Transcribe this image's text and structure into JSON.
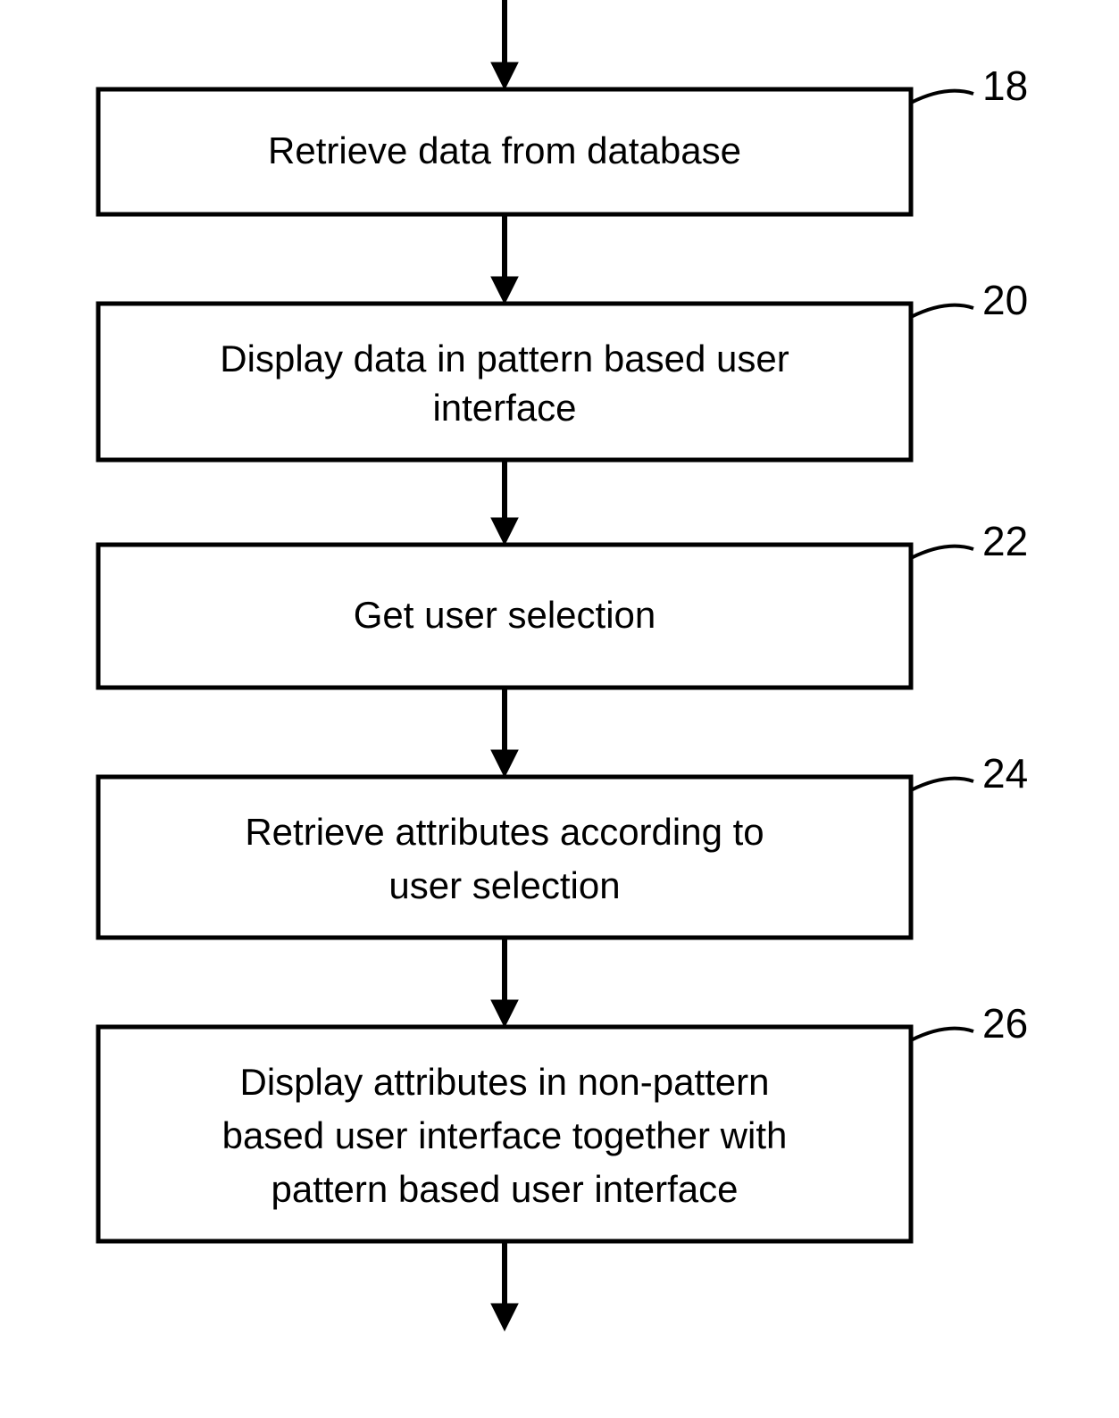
{
  "diagram": {
    "type": "flowchart",
    "orientation": "vertical",
    "steps": [
      {
        "id": "18",
        "label": "18",
        "lines": [
          "Retrieve data from database"
        ]
      },
      {
        "id": "20",
        "label": "20",
        "lines": [
          "Display data in pattern based user",
          "interface"
        ]
      },
      {
        "id": "22",
        "label": "22",
        "lines": [
          "Get user selection"
        ]
      },
      {
        "id": "24",
        "label": "24",
        "lines": [
          "Retrieve attributes according to",
          "user selection"
        ]
      },
      {
        "id": "26",
        "label": "26",
        "lines": [
          "Display attributes in non-pattern",
          "based user interface together with",
          "pattern based user interface"
        ]
      }
    ]
  }
}
